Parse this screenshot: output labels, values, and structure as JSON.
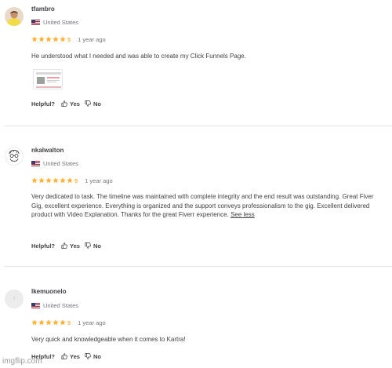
{
  "reviews": [
    {
      "username": "tfambro",
      "country": "United States",
      "rating": "5",
      "age": "1 year ago",
      "comment": "He understood what I needed and was able to create my Click Funnels Page.",
      "helpful_label": "Helpful?",
      "yes_label": "Yes",
      "no_label": "No"
    },
    {
      "username": "nkalwalton",
      "country": "United States",
      "rating": "5",
      "age": "1 year ago",
      "comment": "Very dedicated to task. The timeline was maintained with complete integrity and the end result was outstanding. Great Fiver Gig, excellent experience. Everything is organized and the support conveys professionalism to the gig. Excellent delivered product with Video Explanation. Thanks for the great Fiverr experience.",
      "see_less": "See less",
      "helpful_label": "Helpful?",
      "yes_label": "Yes",
      "no_label": "No"
    },
    {
      "username": "lkemuonelo",
      "avatar_letter": "l",
      "country": "United States",
      "rating": "5",
      "age": "1 year ago",
      "comment": "Very quick and knowledgeable when it comes to Kartra!",
      "helpful_label": "Helpful?",
      "yes_label": "Yes",
      "no_label": "No"
    }
  ],
  "watermark": "imgflip.com",
  "colors": {
    "star": "#ffb33e",
    "text": "#404145",
    "muted": "#74767e",
    "divider": "#e4e5e7"
  },
  "icons": [
    "star-icon",
    "us-flag-icon",
    "thumbs-up-icon",
    "thumbs-down-icon"
  ]
}
